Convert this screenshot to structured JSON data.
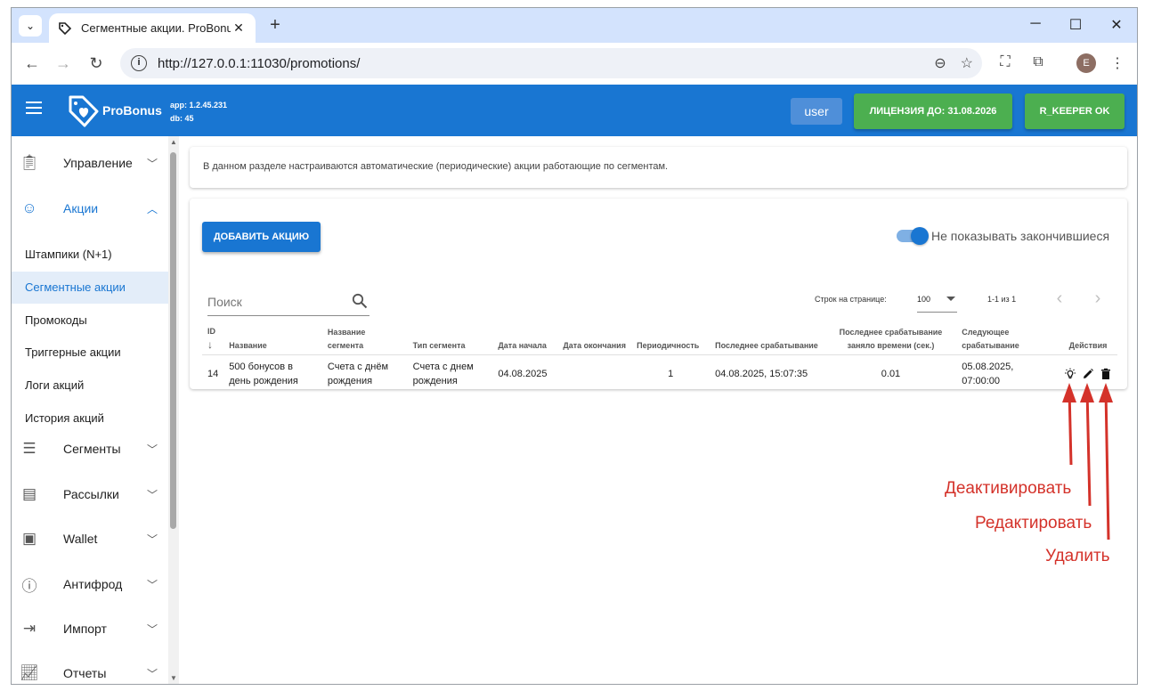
{
  "browser": {
    "tab_title": "Сегментные акции. ProBonus",
    "tab_close": "✕",
    "new_tab": "+",
    "url": "http://127.0.0.1:11030/promotions/",
    "profile_initial": "E"
  },
  "header": {
    "brand": "ProBonus",
    "app_version": "app: 1.2.45.231",
    "db_version": "db: 45",
    "user_label": "user",
    "license_label": "ЛИЦЕНЗИЯ ДО: 31.08.2026",
    "rkeeper_label": "R_KEEPER OK",
    "accent": "#1976d2",
    "success": "#4caf50"
  },
  "sidebar": {
    "groups": [
      {
        "label": "Управление",
        "icon": "clipboard-icon"
      },
      {
        "label": "Акции",
        "icon": "smile-icon"
      },
      {
        "label": "Сегменты",
        "icon": "filter-lines-icon"
      },
      {
        "label": "Рассылки",
        "icon": "card-icon"
      },
      {
        "label": "Wallet",
        "icon": "wallet-icon"
      },
      {
        "label": "Антифрод",
        "icon": "alert-circle-icon"
      },
      {
        "label": "Импорт",
        "icon": "import-icon"
      },
      {
        "label": "Отчеты",
        "icon": "chart-icon"
      }
    ],
    "subitems": [
      {
        "label": "Штампики (N+1)"
      },
      {
        "label": "Сегментные акции"
      },
      {
        "label": "Промокоды"
      },
      {
        "label": "Триггерные акции"
      },
      {
        "label": "Логи акций"
      },
      {
        "label": "История акций"
      }
    ]
  },
  "main": {
    "info_text": "В данном разделе настраиваются автоматические (периодические) акции работающие по сегментам.",
    "add_button": "ДОБАВИТЬ АКЦИЮ",
    "toggle_label": "Не показывать закончившиеся",
    "search_placeholder": "Поиск",
    "rows_per_page_label": "Строк на странице:",
    "rows_per_page_value": "100",
    "page_info": "1-1 из 1"
  },
  "table": {
    "headers": {
      "id": "ID",
      "name": "Название",
      "segment_name": "Название сегмента",
      "segment_type": "Тип сегмента",
      "start_date": "Дата начала",
      "end_date": "Дата окончания",
      "period": "Периодичность",
      "last_run": "Последнее срабатывание",
      "last_run_time": "Последнее срабатывание заняло времени (сек.)",
      "next_run": "Следующее срабатывание",
      "actions": "Действия"
    },
    "rows": [
      {
        "id": "14",
        "name": "500 бонусов в день рождения",
        "segment_name": "Счета с днём рождения",
        "segment_type": "Счета с днем рождения",
        "start_date": "04.08.2025",
        "end_date": "",
        "period": "1",
        "last_run": "04.08.2025, 15:07:35",
        "last_run_time": "0.01",
        "next_run": "05.08.2025, 07:00:00"
      }
    ]
  },
  "annotations": {
    "deactivate": "Деактивировать",
    "edit": "Редактировать",
    "delete": "Удалить",
    "color": "#d4322a"
  }
}
